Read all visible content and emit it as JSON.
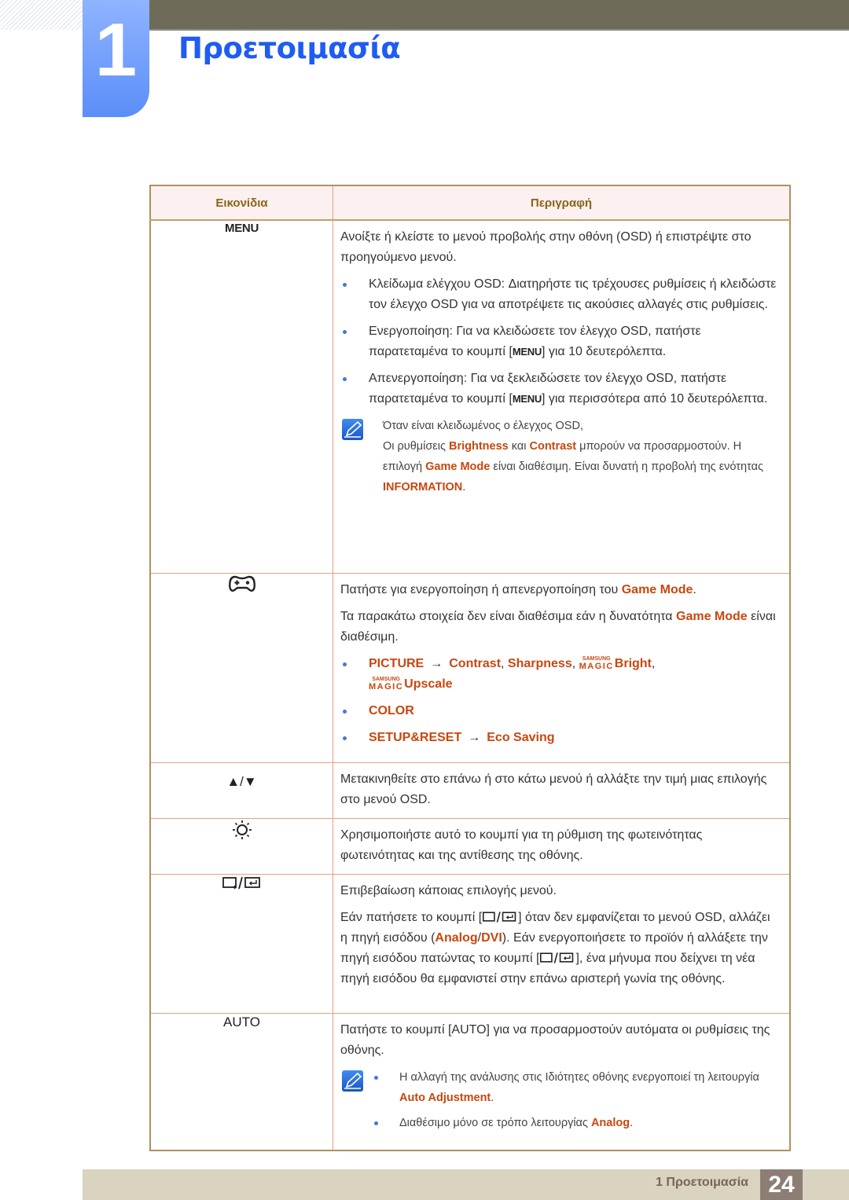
{
  "chapter": {
    "number": "1",
    "title": "Προετοιμασία"
  },
  "table": {
    "headers": {
      "icons": "Εικονίδια",
      "description": "Περιγραφή"
    },
    "rows": {
      "menu": {
        "icon_label": "MENU",
        "intro": "Ανοίξτε ή κλείστε το μενού προβολής στην οθόνη (OSD) ή επιστρέψτε στο προηγούμενο μενού.",
        "bullets": [
          {
            "text": "Κλείδωμα ελέγχου OSD: Διατηρήστε τις τρέχουσες ρυθμίσεις ή κλειδώστε τον έλεγχο OSD για να αποτρέψετε τις ακούσιες αλλαγές στις ρυθμίσεις."
          },
          {
            "before": "Ενεργοποίηση: Για να κλειδώσετε τον έλεγχο OSD, πατήστε παρατεταμένα το κουμπί [",
            "key": "MENU",
            "after": "] για 10 δευτερόλεπτα."
          },
          {
            "before": "Απενεργοποίηση: Για να ξεκλειδώσετε τον έλεγχο OSD, πατήστε παρατεταμένα το κουμπί [",
            "key": "MENU",
            "after": "] για περισσότερα από 10 δευτερόλεπτα."
          }
        ],
        "note": {
          "line1": "Όταν είναι κλειδωμένος ο έλεγχος OSD,",
          "t1": "Οι ρυθμίσεις ",
          "h1": "Brightness",
          "t2": " και ",
          "h2": "Contrast",
          "t3": " μπορούν να προσαρμοστούν. Η επιλογή ",
          "h3": "Game Mode",
          "t4": " είναι διαθέσιμη. Είναι δυνατή η προβολή της ενότητας ",
          "h4": "INFORMATION",
          "t5": "."
        }
      },
      "game": {
        "icon": "gamepad-icon",
        "p1_text": "Πατήστε για ενεργοποίηση ή απενεργοποίηση του ",
        "p1_hl": "Game Mode",
        "p1_end": ".",
        "p2_text": "Τα παρακάτω στοιχεία δεν είναι διαθέσιμα εάν η δυνατότητα ",
        "p2_hl": "Game Mode",
        "p2_end": " είναι διαθέσιμη.",
        "magic_small": "SAMSUNG",
        "magic_big": "MAGIC",
        "arrow": "→",
        "bullet1": {
          "menu": "PICTURE",
          "items": [
            "Contrast",
            "Sharpness",
            "Bright",
            "Upscale"
          ]
        },
        "bullet2": {
          "menu": "COLOR"
        },
        "bullet3": {
          "menu": "SETUP&RESET",
          "item": "Eco Saving"
        }
      },
      "updown": {
        "icon_label": "▲/▼",
        "text": "Μετακινηθείτε στο επάνω ή στο κάτω μενού ή αλλάξτε την τιμή μιας επιλογής στο μενού OSD."
      },
      "brightness": {
        "icon": "brightness-sun-icon",
        "text": "Χρησιμοποιήστε αυτό το κουμπί για τη ρύθμιση της φωτεινότητας φωτεινότητας και της αντίθεσης της οθόνης."
      },
      "source": {
        "icon": "source-enter-icon",
        "p1": "Επιβεβαίωση κάποιας επιλογής μενού.",
        "t1": "Εάν πατήσετε το κουμπί [",
        "t2": "] όταν δεν εμφανίζεται το μενού OSD, αλλάζει η πηγή εισόδου (",
        "h1": "Analog",
        "slash": "/",
        "h2": "DVI",
        "t3": "). Εάν ενεργοποιήσετε το προϊόν ή αλλάξετε την πηγή εισόδου πατώντας το κουμπί [",
        "t4": "], ένα μήνυμα που δείχνει τη νέα πηγή εισόδου θα εμφανιστεί στην επάνω αριστερή γωνία της οθόνης."
      },
      "auto": {
        "icon_label": "AUTO",
        "p1": "Πατήστε το κουμπί [AUTO] για να προσαρμοστούν αυτόματα οι ρυθμίσεις της οθόνης.",
        "note_b1_text": "Η αλλαγή της ανάλυσης στις Ιδιότητες οθόνης ενεργοποιεί τη λειτουργία ",
        "note_b1_hl": "Auto Adjustment",
        "note_b1_end": ".",
        "note_b2_text": "Διαθέσιμο μόνο σε τρόπο λειτουργίας ",
        "note_b2_hl": "Analog",
        "note_b2_end": "."
      }
    }
  },
  "footer": {
    "label": "1 Προετοιμασία",
    "page": "24"
  }
}
